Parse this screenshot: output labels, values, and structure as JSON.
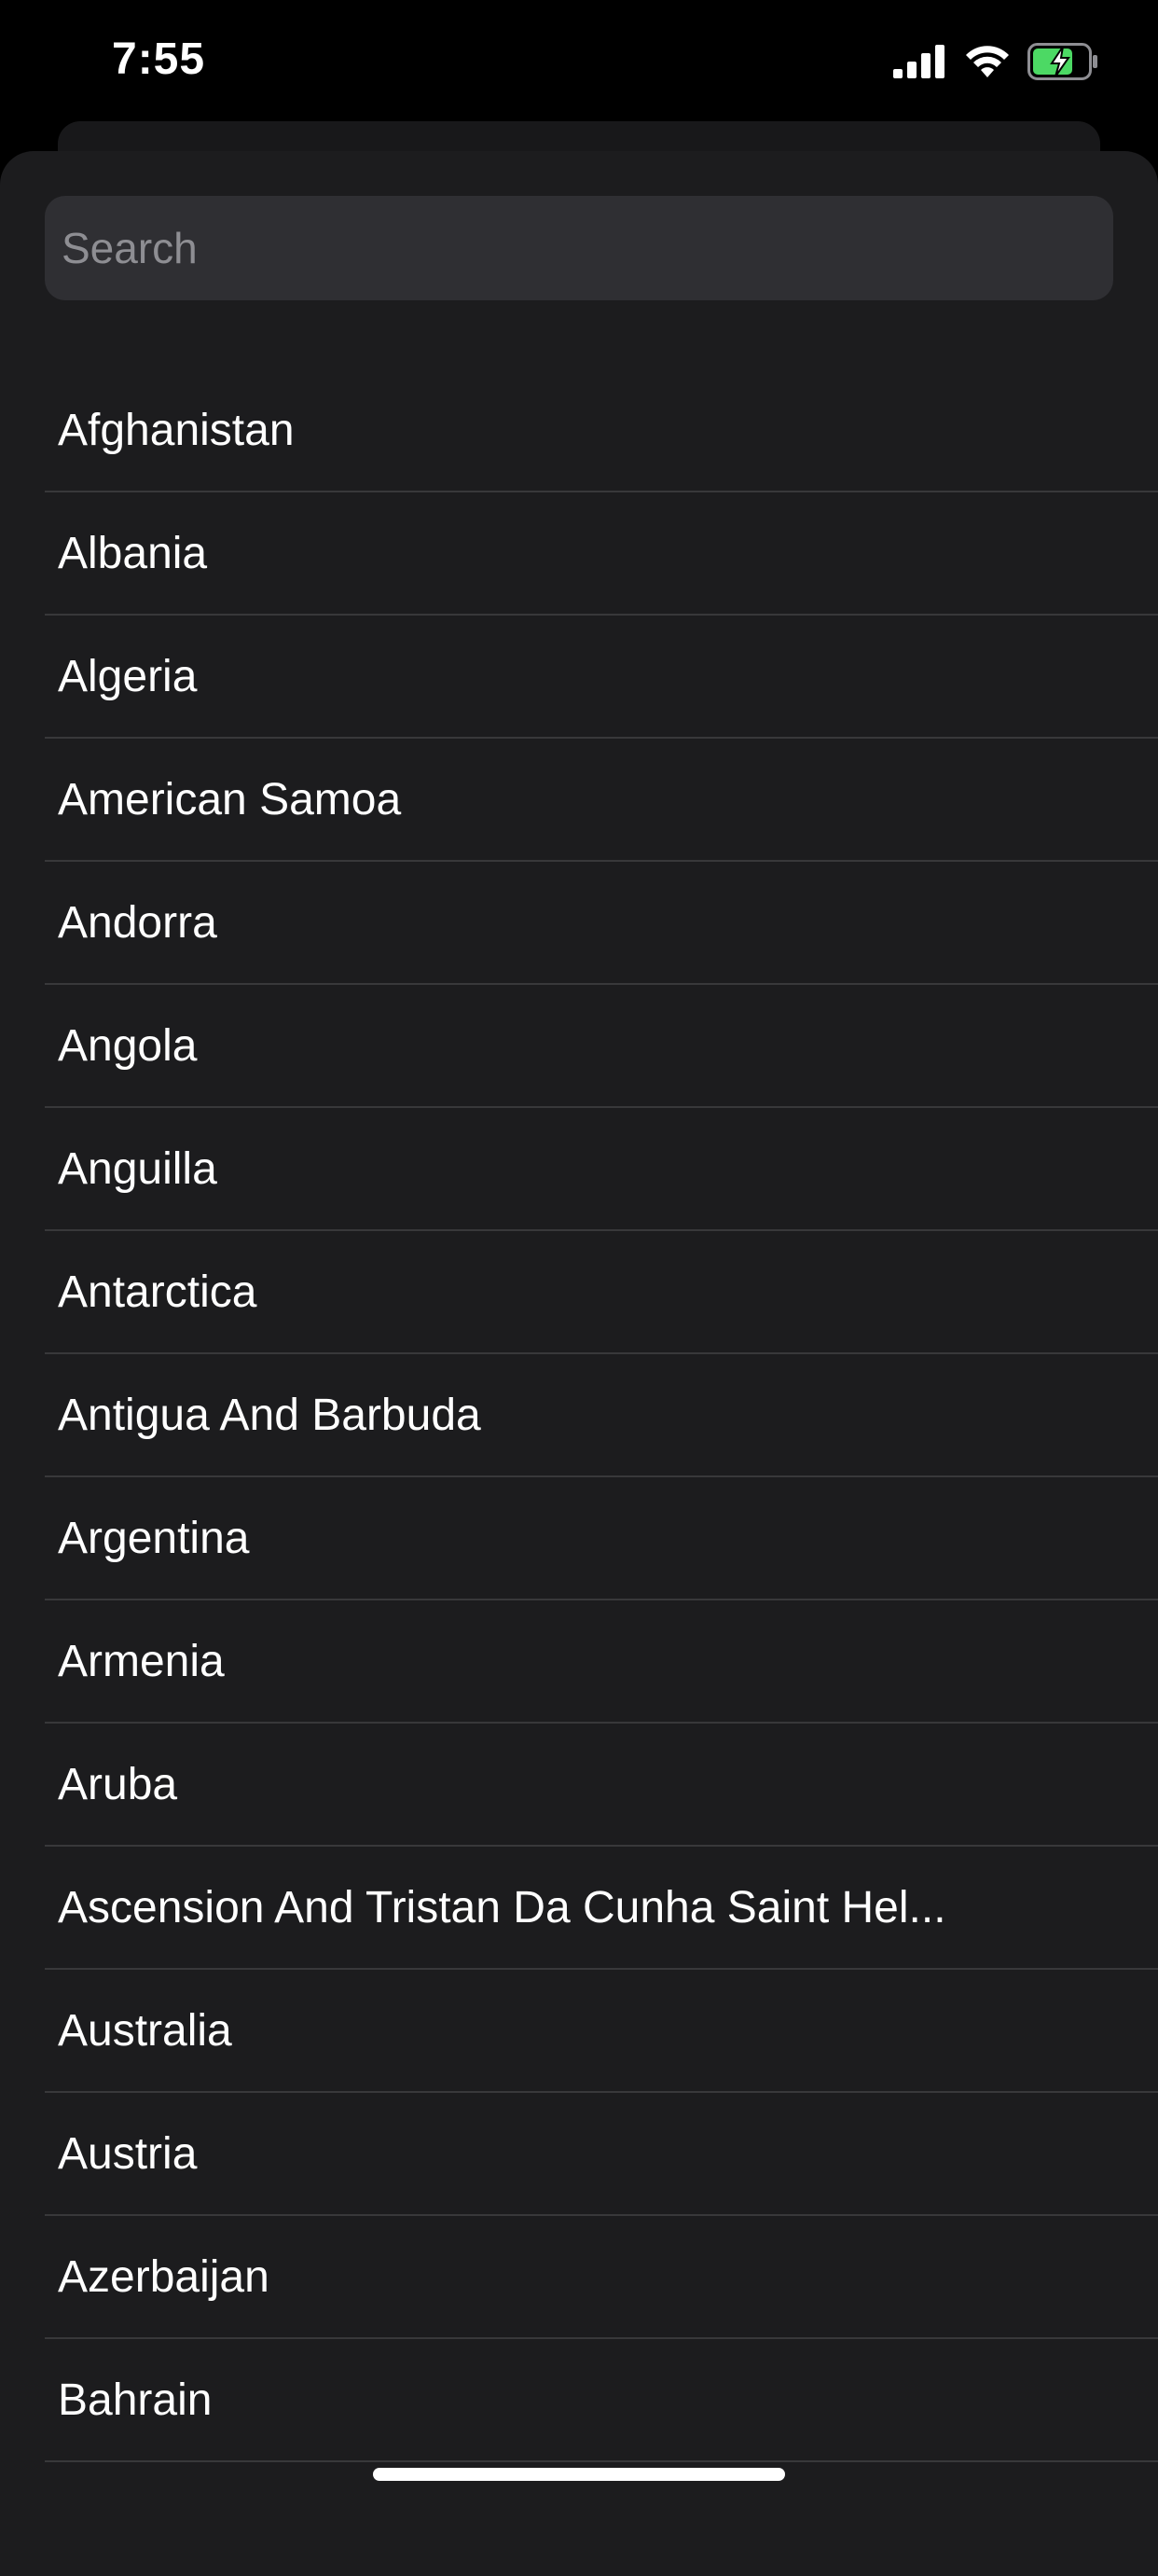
{
  "status_bar": {
    "time": "7:55",
    "icons": [
      "cellular-signal-icon",
      "wifi-icon",
      "battery-charging-icon"
    ],
    "battery_color": "#4cd964"
  },
  "search": {
    "placeholder": "Search",
    "value": ""
  },
  "countries": [
    "Afghanistan",
    "Albania",
    "Algeria",
    "American Samoa",
    "Andorra",
    "Angola",
    "Anguilla",
    "Antarctica",
    "Antigua And Barbuda",
    "Argentina",
    "Armenia",
    "Aruba",
    "Ascension And Tristan Da Cunha Saint Hel...",
    "Australia",
    "Austria",
    "Azerbaijan",
    "Bahrain"
  ]
}
